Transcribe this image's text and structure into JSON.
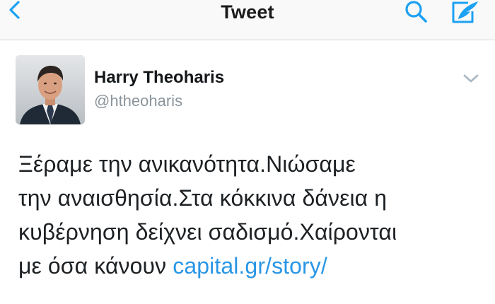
{
  "nav": {
    "title": "Tweet",
    "back_icon": "chevron-left-icon",
    "search_icon": "search-icon",
    "compose_icon": "compose-icon",
    "accent_color": "#1da1f2"
  },
  "tweet": {
    "author": {
      "name": "Harry Theoharis",
      "handle": "@htheoharis",
      "avatar_icon": "profile-photo"
    },
    "menu_icon": "chevron-down-icon",
    "text_lines": [
      "Ξέραμε την ανικανότητα.Νιώσαμε",
      "την αναισθησία.Στα κόκκινα δάνεια η",
      "κυβέρνηση δείχνει σαδισμό.Χαίρονται",
      "με όσα κάνουν "
    ],
    "link": "capital.gr/story/",
    "link_color": "#2a96e5"
  }
}
